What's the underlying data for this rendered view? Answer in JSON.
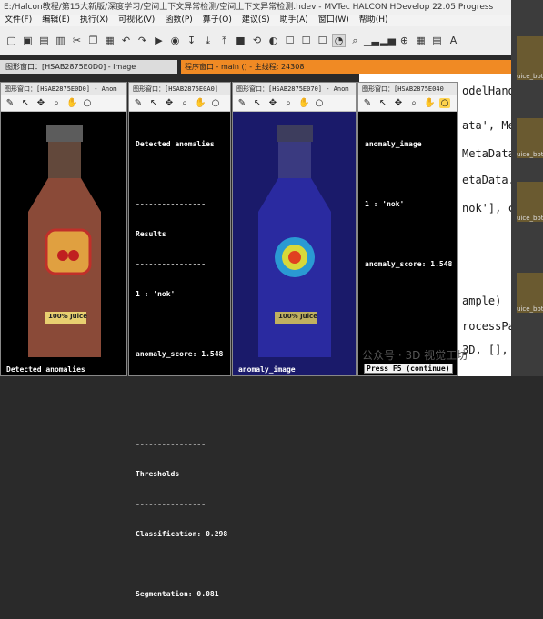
{
  "app": {
    "title": "E:/Halcon教程/第15大新版/深度学习/空间上下文异常检测/空间上下文异常检测.hdev - MVTec HALCON HDevelop 22.05 Progress",
    "menu": [
      "文件(F)",
      "编辑(E)",
      "执行(X)",
      "可视化(V)",
      "函数(P)",
      "算子(O)",
      "建议(S)",
      "助手(A)",
      "窗口(W)",
      "帮助(H)"
    ]
  },
  "graphics_main": {
    "title": "图形窗口：[HSAB2875E0D0] - Image"
  },
  "program_window": {
    "title": "程序窗口 - main () - 主线程: 24308"
  },
  "code_lines": [
    "odelHandle",
    "ata', Meta",
    "MetaData.",
    "etaData.an",
    "nok'], cl",
    "ample)",
    "rocessPar",
    "3D, [], DLF"
  ],
  "windows": [
    {
      "title": "图形窗口：[HSAB2875E0D0] - Anom",
      "caption": "Detected anomalies",
      "label": "100% Juice"
    },
    {
      "title": "图形窗口：[HSAB2875E0A0]",
      "lines": [
        "Detected anomalies",
        "",
        "----------------",
        "Results",
        "----------------",
        "1 : 'nok'",
        "",
        "anomaly_score: 1.548",
        "",
        "",
        "----------------",
        "Thresholds",
        "----------------",
        "Classification: 0.298",
        "",
        "Segmentation: 0.081"
      ]
    },
    {
      "title": "图形窗口：[HSAB2875E070] - Anom",
      "caption": "anomaly_image",
      "label": "100% Juice"
    },
    {
      "title": "图形窗口：[HSAB2875E040",
      "lines": [
        "anomaly_image",
        "",
        "1 : 'nok'",
        "",
        "anomaly_score: 1.548"
      ],
      "button": "Press F5 (continue)"
    }
  ],
  "watermark": "公众号 · 3D 视觉工坊",
  "side_thumbs": [
    "uice_bot_",
    "uice_bot_",
    "uice_bot_",
    "uice_bot_"
  ]
}
